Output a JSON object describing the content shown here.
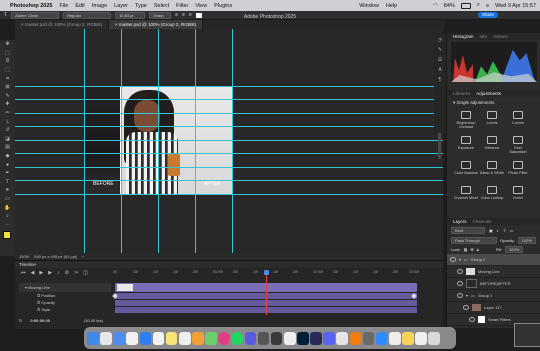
{
  "menubar": {
    "app_name": "Photoshop 2025",
    "items": [
      "File",
      "Edit",
      "Image",
      "Layer",
      "Type",
      "Select",
      "Filter",
      "View",
      "Plugins",
      "Window",
      "Help"
    ],
    "battery": "84%",
    "datetime": "Wed 9 Apr 15:57"
  },
  "options": {
    "font_family": "Adobe Clean",
    "font_style": "Regular",
    "font_size": "15.83 pt",
    "antialias": "Sharp",
    "share_label": "Share"
  },
  "window_title": "Adobe Photoshop 2025",
  "tabs": [
    {
      "label": "master.psd @ 100% (Group 2, RGB/8)"
    },
    {
      "label": "master.psd @ 100% (Group 2, RGB/8)"
    }
  ],
  "canvas": {
    "before_label": "BEFORE",
    "after_label": "AFTER"
  },
  "status": {
    "zoom": "150%",
    "doc_size": "540 px x 405 px (81 ppi)"
  },
  "timeline": {
    "title": "Timeline",
    "ruler_ticks": [
      "00",
      "05f",
      "10f",
      "15f",
      "20f",
      "01:00f",
      "05f",
      "10f",
      "15f",
      "20f",
      "02:00f",
      "05f",
      "10f",
      "15f",
      "20f",
      "03:00f"
    ],
    "tracks": [
      {
        "label": "Moving Line"
      },
      {
        "label": "Position"
      },
      {
        "label": "Opacity"
      },
      {
        "label": "Style"
      }
    ],
    "timecode": "0:00:00:00",
    "fps": "(30.00 fps)"
  },
  "panels": {
    "top_tabs": [
      "Histogram",
      "Info",
      "Actions"
    ],
    "mid_tabs": [
      "Libraries",
      "Adjustments"
    ],
    "adjust_header": "Single adjustments",
    "adjustments": [
      {
        "label": "Brightness/ Contrast"
      },
      {
        "label": "Levels"
      },
      {
        "label": "Curves"
      },
      {
        "label": "Exposure"
      },
      {
        "label": "Vibrance"
      },
      {
        "label": "Hue/ Saturation"
      },
      {
        "label": "Color Balance"
      },
      {
        "label": "Black & White"
      },
      {
        "label": "Photo Filter"
      },
      {
        "label": "Channel Mixer"
      },
      {
        "label": "Color Lookup"
      },
      {
        "label": "Invert"
      }
    ],
    "layer_tabs": [
      "Layers",
      "Channels"
    ],
    "layer_filter": "Kind",
    "blend_mode": "Pass Through",
    "opacity_label": "Opacity:",
    "opacity_value": "100%",
    "lock_label": "Lock:",
    "fill_label": "Fill:",
    "fill_value": "100%",
    "layers": [
      {
        "name": "Group 2"
      },
      {
        "name": "Moving Line"
      },
      {
        "name": "BEFORE|AFTER"
      },
      {
        "name": "Group 1"
      },
      {
        "name": "Layer 117"
      },
      {
        "name": "Smart Filters"
      }
    ]
  },
  "colors": {
    "accent": "#1473e6",
    "guide": "#33c7d6",
    "track": "#7a6cb5",
    "playhead": "#e0413a"
  }
}
